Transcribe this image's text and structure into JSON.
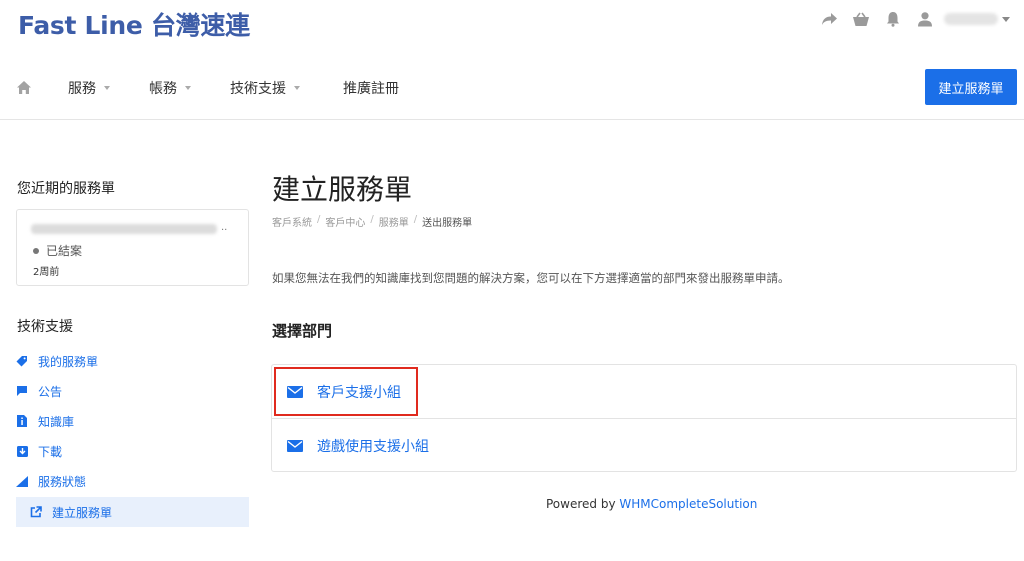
{
  "brand": {
    "title": "Fast Line 台灣速連"
  },
  "topbar_icons": [
    "share-icon",
    "basket-icon",
    "bell-icon",
    "user-icon"
  ],
  "nav": {
    "items": [
      {
        "label": "服務",
        "has_dropdown": true
      },
      {
        "label": "帳務",
        "has_dropdown": true
      },
      {
        "label": "技術支援",
        "has_dropdown": true
      },
      {
        "label": "推廣註冊",
        "has_dropdown": false
      }
    ],
    "cta_label": "建立服務單"
  },
  "sidebar": {
    "recent_title": "您近期的服務單",
    "recent_ticket": {
      "dots": "..",
      "status": "已結案",
      "time": "2周前"
    },
    "support_title": "技術支援",
    "items": [
      {
        "label": "我的服務單",
        "icon": "tag-icon"
      },
      {
        "label": "公告",
        "icon": "comment-icon"
      },
      {
        "label": "知識庫",
        "icon": "info-doc-icon"
      },
      {
        "label": "下載",
        "icon": "download-icon"
      },
      {
        "label": "服務狀態",
        "icon": "signal-icon"
      },
      {
        "label": "建立服務單",
        "icon": "external-link-icon",
        "active": true
      }
    ]
  },
  "main": {
    "title": "建立服務單",
    "breadcrumb": [
      "客戶系統",
      "客戶中心",
      "服務單",
      "送出服務單"
    ],
    "intro": "如果您無法在我們的知識庫找到您問題的解決方案，您可以在下方選擇適當的部門來發出服務單申請。",
    "section_title": "選擇部門",
    "departments": [
      "客戶支援小組",
      "遊戲使用支援小組"
    ]
  },
  "footer": {
    "powered_by": "Powered by",
    "powered_link": "WHMCompleteSolution"
  },
  "colors": {
    "brand": "#3d5da8",
    "accent": "#1b6fe8",
    "highlight": "#e02a1e"
  }
}
